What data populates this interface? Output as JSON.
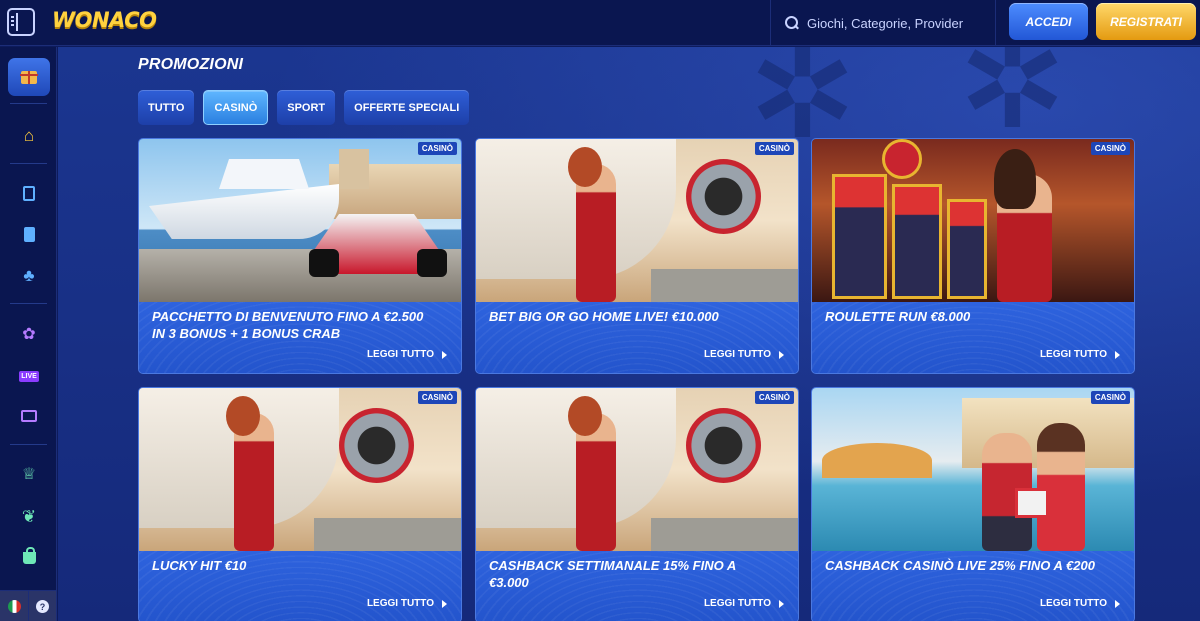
{
  "header": {
    "logo": "WONACO",
    "search_placeholder": "Giochi, Categorie, Provider",
    "login_label": "ACCEDI",
    "register_label": "REGISTRATI"
  },
  "sidebar": {
    "items": [
      {
        "name": "promotions",
        "icon": "gift-icon",
        "active": true
      },
      {
        "name": "home",
        "icon": "home-icon"
      },
      {
        "name": "slots",
        "icon": "slot-machine-icon"
      },
      {
        "name": "cards",
        "icon": "card-icon"
      },
      {
        "name": "lucky",
        "icon": "clover-icon"
      },
      {
        "name": "casino-games",
        "icon": "chip-icon"
      },
      {
        "name": "live",
        "icon": "live-icon",
        "label": "LIVE"
      },
      {
        "name": "live-tv",
        "icon": "tv-icon"
      },
      {
        "name": "tournaments",
        "icon": "trophy-icon"
      },
      {
        "name": "sport",
        "icon": "leaf-icon"
      },
      {
        "name": "shop",
        "icon": "bag-icon"
      }
    ],
    "language_icon": "italy-flag-icon",
    "help_label": "?"
  },
  "page": {
    "title": "PROMOZIONI",
    "tabs": [
      {
        "label": "TUTTO",
        "active": false
      },
      {
        "label": "CASINÒ",
        "active": true
      },
      {
        "label": "SPORT",
        "active": false
      },
      {
        "label": "OFFERTE SPECIALI",
        "active": false
      }
    ]
  },
  "cards": [
    {
      "badge": "CASINÒ",
      "title_line1": "PACCHETTO DI BENVENUTO FINO A €2.500",
      "title_line2": "IN 3 BONUS + 1 BONUS CRAB",
      "more": "LEGGI TUTTO",
      "scene": "yacht-racecar"
    },
    {
      "badge": "CASINÒ",
      "title_line1": "BET BIG OR GO HOME LIVE! €10.000",
      "title_line2": "",
      "more": "LEGGI TUTTO",
      "scene": "jet-woman"
    },
    {
      "badge": "CASINÒ",
      "title_line1": "ROULETTE RUN €8.000",
      "title_line2": "",
      "more": "LEGGI TUTTO",
      "scene": "slot-woman"
    },
    {
      "badge": "CASINÒ",
      "title_line1": "LUCKY HIT €10",
      "title_line2": "",
      "more": "LEGGI TUTTO",
      "scene": "jet-woman"
    },
    {
      "badge": "CASINÒ",
      "title_line1": "CASHBACK SETTIMANALE 15% FINO A",
      "title_line2": "€3.000",
      "more": "LEGGI TUTTO",
      "scene": "jet-woman"
    },
    {
      "badge": "CASINÒ",
      "title_line1": "CASHBACK CASINÒ LIVE 25% FINO A €200",
      "title_line2": "",
      "more": "LEGGI TUTTO",
      "scene": "pool-couple"
    }
  ],
  "colors": {
    "background": "#15297a",
    "topbar": "#0a1650",
    "accent_blue": "#2a7fe0",
    "accent_gold": "#e49a10",
    "logo": "#ffd23f"
  }
}
